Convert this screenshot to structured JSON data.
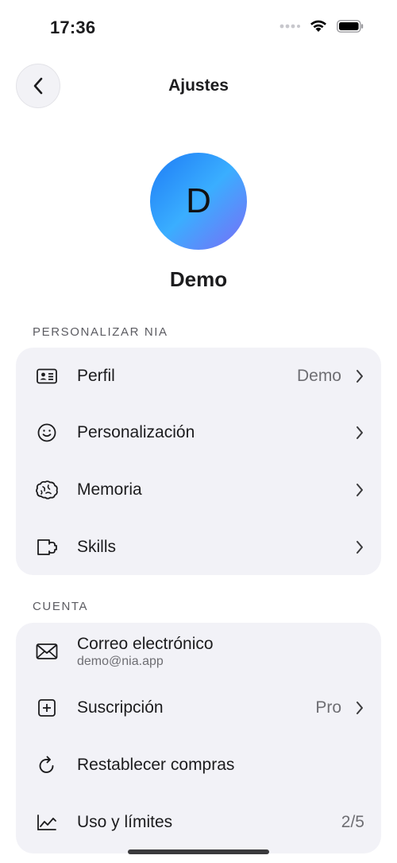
{
  "status_bar": {
    "time": "17:36"
  },
  "header": {
    "title": "Ajustes"
  },
  "profile": {
    "initial": "D",
    "name": "Demo"
  },
  "sections": {
    "personalize": {
      "header": "PERSONALIZAR NIA",
      "items": [
        {
          "label": "Perfil",
          "value": "Demo",
          "icon": "id-card-icon"
        },
        {
          "label": "Personalización",
          "icon": "smiley-icon"
        },
        {
          "label": "Memoria",
          "icon": "brain-icon"
        },
        {
          "label": "Skills",
          "icon": "puzzle-icon"
        }
      ]
    },
    "account": {
      "header": "CUENTA",
      "items": [
        {
          "label": "Correo electrónico",
          "sublabel": "demo@nia.app",
          "icon": "envelope-icon"
        },
        {
          "label": "Suscripción",
          "value": "Pro",
          "icon": "plus-square-icon"
        },
        {
          "label": "Restablecer compras",
          "icon": "refresh-icon"
        },
        {
          "label": "Uso y límites",
          "value": "2/5",
          "icon": "chart-line-icon"
        }
      ]
    }
  },
  "colors": {
    "card_background": "#f2f2f7",
    "avatar_gradient": [
      "#1e7bf5",
      "#3aaeff",
      "#7b6cf6"
    ],
    "secondary_text": "#6e6e73"
  }
}
